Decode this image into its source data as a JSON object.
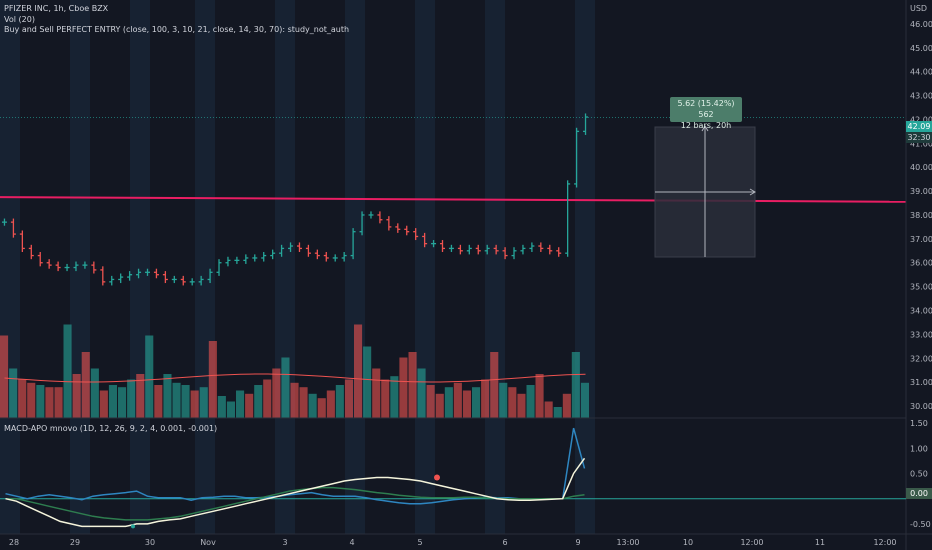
{
  "header": {
    "symbol_line": "PFIZER INC, 1h, Cboe BZX",
    "volume_line": "Vol (20)",
    "study_line": "Buy and Sell PERFECT ENTRY (close, 100, 3, 10, 21, close, 14, 30, 70): study_not_auth"
  },
  "macd_legend": "MACD-APO mnovo (1D, 12, 26, 9, 2, 4, 0.001, -0.001)",
  "currency": "USD",
  "last_price_label": "42.09",
  "countdown_label": "32:30",
  "macd_zero_label": "0.00",
  "measure_tooltip": {
    "line1": "5.62 (15.42%) 562",
    "line2": "12 bars, 20h"
  },
  "colors": {
    "background": "#131722",
    "up": "#26a69a",
    "down": "#ef5350",
    "ma_line": "#e91e63",
    "session_band": "#1c2b40"
  },
  "price_axis": [
    "46.00",
    "45.00",
    "44.00",
    "43.00",
    "42.00",
    "41.00",
    "40.00",
    "39.00",
    "38.00",
    "37.00",
    "36.00",
    "35.00",
    "34.00",
    "33.00",
    "32.00",
    "31.00",
    "30.00"
  ],
  "macd_axis": [
    "1.50",
    "1.00",
    "0.50",
    "-0.50"
  ],
  "time_axis": [
    "28",
    "29",
    "30",
    "Nov",
    "3",
    "4",
    "5",
    "6",
    "9",
    "13:00",
    "10",
    "12:00",
    "11",
    "12:00"
  ],
  "chart_data": {
    "type": "bar",
    "title": "",
    "price_range": [
      29.5,
      47
    ],
    "moving_average_level": 38.6,
    "price_bars_close": [
      37.7,
      37.2,
      36.6,
      36.3,
      36.0,
      35.9,
      35.8,
      35.8,
      35.9,
      35.9,
      35.7,
      35.2,
      35.3,
      35.4,
      35.5,
      35.6,
      35.6,
      35.5,
      35.3,
      35.3,
      35.2,
      35.2,
      35.3,
      35.6,
      36.0,
      36.1,
      36.1,
      36.2,
      36.2,
      36.3,
      36.4,
      36.6,
      36.7,
      36.6,
      36.4,
      36.3,
      36.2,
      36.2,
      36.3,
      37.3,
      38.0,
      38.0,
      37.8,
      37.5,
      37.4,
      37.3,
      37.1,
      36.8,
      36.8,
      36.6,
      36.6,
      36.5,
      36.6,
      36.5,
      36.6,
      36.5,
      36.3,
      36.5,
      36.6,
      36.7,
      36.6,
      36.5,
      36.4,
      39.3,
      41.5,
      42.1
    ],
    "volume_bars": [
      0.75,
      0.45,
      0.35,
      0.32,
      0.3,
      0.28,
      0.28,
      0.85,
      0.4,
      0.6,
      0.45,
      0.25,
      0.3,
      0.28,
      0.35,
      0.4,
      0.75,
      0.3,
      0.4,
      0.32,
      0.3,
      0.25,
      0.28,
      0.7,
      0.2,
      0.15,
      0.25,
      0.22,
      0.3,
      0.35,
      0.45,
      0.55,
      0.32,
      0.28,
      0.22,
      0.18,
      0.25,
      0.3,
      0.35,
      0.85,
      0.65,
      0.45,
      0.35,
      0.38,
      0.55,
      0.6,
      0.45,
      0.3,
      0.22,
      0.28,
      0.32,
      0.25,
      0.28,
      0.35,
      0.6,
      0.32,
      0.28,
      0.22,
      0.3,
      0.4,
      0.15,
      0.1,
      0.22,
      0.6,
      0.32
    ],
    "macd_range": [
      -0.7,
      1.6
    ],
    "macd_fast": [
      0.0,
      -0.05,
      -0.15,
      -0.25,
      -0.35,
      -0.45,
      -0.5,
      -0.55,
      -0.55,
      -0.55,
      -0.55,
      -0.55,
      -0.5,
      -0.5,
      -0.45,
      -0.42,
      -0.4,
      -0.35,
      -0.3,
      -0.25,
      -0.2,
      -0.15,
      -0.1,
      -0.05,
      0.0,
      0.05,
      0.1,
      0.15,
      0.2,
      0.25,
      0.3,
      0.35,
      0.38,
      0.4,
      0.42,
      0.42,
      0.4,
      0.38,
      0.35,
      0.3,
      0.25,
      0.2,
      0.15,
      0.1,
      0.05,
      0.0,
      -0.02,
      -0.03,
      -0.03,
      -0.02,
      -0.01,
      0.0,
      0.5,
      0.8
    ],
    "macd_slow": [
      0.0,
      0.0,
      -0.05,
      -0.1,
      -0.15,
      -0.2,
      -0.25,
      -0.3,
      -0.35,
      -0.38,
      -0.4,
      -0.42,
      -0.42,
      -0.42,
      -0.4,
      -0.38,
      -0.35,
      -0.3,
      -0.25,
      -0.2,
      -0.15,
      -0.1,
      -0.05,
      0.0,
      0.05,
      0.1,
      0.15,
      0.18,
      0.2,
      0.22,
      0.22,
      0.2,
      0.18,
      0.15,
      0.12,
      0.1,
      0.07,
      0.05,
      0.03,
      0.02,
      0.02,
      0.02,
      0.03,
      0.03,
      0.02,
      0.01,
      0.0,
      0.0,
      0.0,
      0.0,
      0.0,
      0.0,
      0.05,
      0.08
    ],
    "macd_hist": [
      0.1,
      0.05,
      0.0,
      0.05,
      0.08,
      0.05,
      0.02,
      -0.02,
      0.05,
      0.08,
      0.1,
      0.12,
      0.15,
      0.05,
      0.02,
      0.02,
      0.02,
      -0.03,
      0.02,
      0.03,
      0.05,
      0.05,
      0.02,
      0.02,
      0.03,
      0.05,
      0.08,
      0.1,
      0.12,
      0.08,
      0.05,
      0.05,
      0.05,
      0.02,
      -0.02,
      -0.05,
      -0.08,
      -0.1,
      -0.1,
      -0.08,
      -0.05,
      -0.02,
      0.0,
      0.02,
      0.03,
      0.02,
      0.02,
      0.0,
      0.0,
      0.0,
      0.0,
      0.0,
      1.4,
      0.6
    ]
  }
}
